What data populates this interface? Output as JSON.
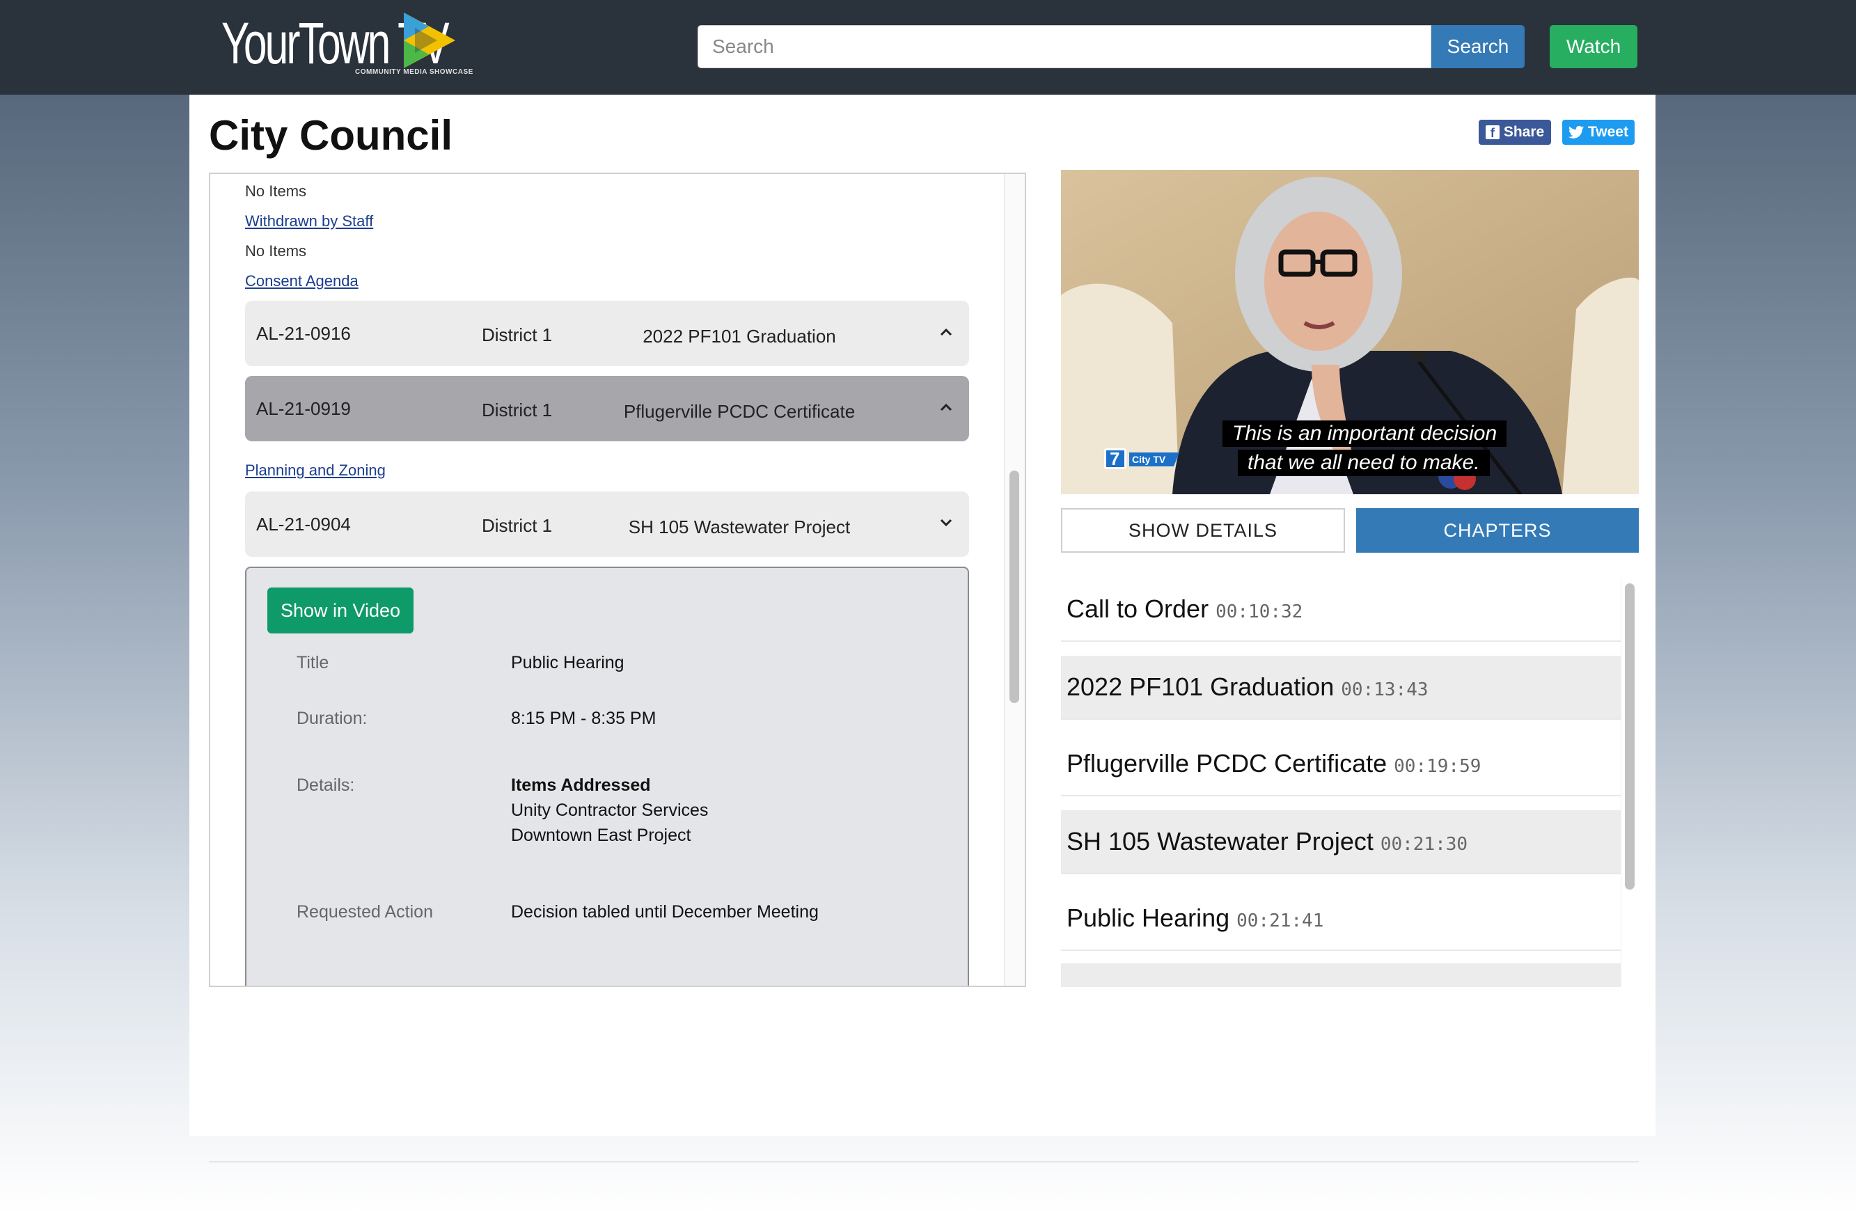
{
  "brand": {
    "logo_text": "YourTown TV",
    "tagline": "COMMUNITY MEDIA SHOWCASE",
    "colors": {
      "navbar": "#2a323c",
      "primary": "#337ab7",
      "success": "#27ae60",
      "green_btn": "#0f9a6a"
    }
  },
  "header": {
    "search_placeholder": "Search",
    "search_button": "Search",
    "watch_button": "Watch"
  },
  "page": {
    "title": "City Council",
    "share_label": "Share",
    "tweet_label": "Tweet"
  },
  "agenda": {
    "no_items_1": "No Items",
    "withdrawn_label": "Withdrawn by Staff",
    "no_items_2": "No Items",
    "consent_label": "Consent Agenda",
    "planning_label": "Planning and Zoning",
    "items": [
      {
        "id": "AL-21-0916",
        "district": "District 1",
        "name": "2022 PF101 Graduation",
        "expanded": true
      },
      {
        "id": "AL-21-0919",
        "district": "District 1",
        "name": "Pflugerville PCDC Certificate",
        "expanded": true,
        "active": true
      },
      {
        "id": "AL-21-0904",
        "district": "District 1",
        "name": "SH 105 Wastewater Project",
        "expanded": false
      }
    ],
    "detail": {
      "show_in_video": "Show in Video",
      "title_label": "Title",
      "title_value": "Public Hearing",
      "duration_label": "Duration:",
      "duration_value": "8:15 PM - 8:35 PM",
      "details_label": "Details:",
      "details_heading": "Items Addressed",
      "details_line1": "Unity Contractor Services",
      "details_line2": "Downtown East Project",
      "action_label": "Requested Action",
      "action_value": "Decision tabled until December Meeting"
    }
  },
  "video": {
    "caption_line1": "This is an important decision",
    "caption_line2": "that we all need to make.",
    "channel_number": "7",
    "channel_name": "City TV"
  },
  "tabs": {
    "show_details": "SHOW DETAILS",
    "chapters": "CHAPTERS"
  },
  "chapters": [
    {
      "title": "Call to Order",
      "time": "00:10:32"
    },
    {
      "title": "2022 PF101 Graduation",
      "time": "00:13:43"
    },
    {
      "title": "Pflugerville PCDC Certificate",
      "time": "00:19:59"
    },
    {
      "title": "SH 105 Wastewater Project",
      "time": "00:21:30"
    },
    {
      "title": "Public Hearing",
      "time": "00:21:41"
    }
  ]
}
